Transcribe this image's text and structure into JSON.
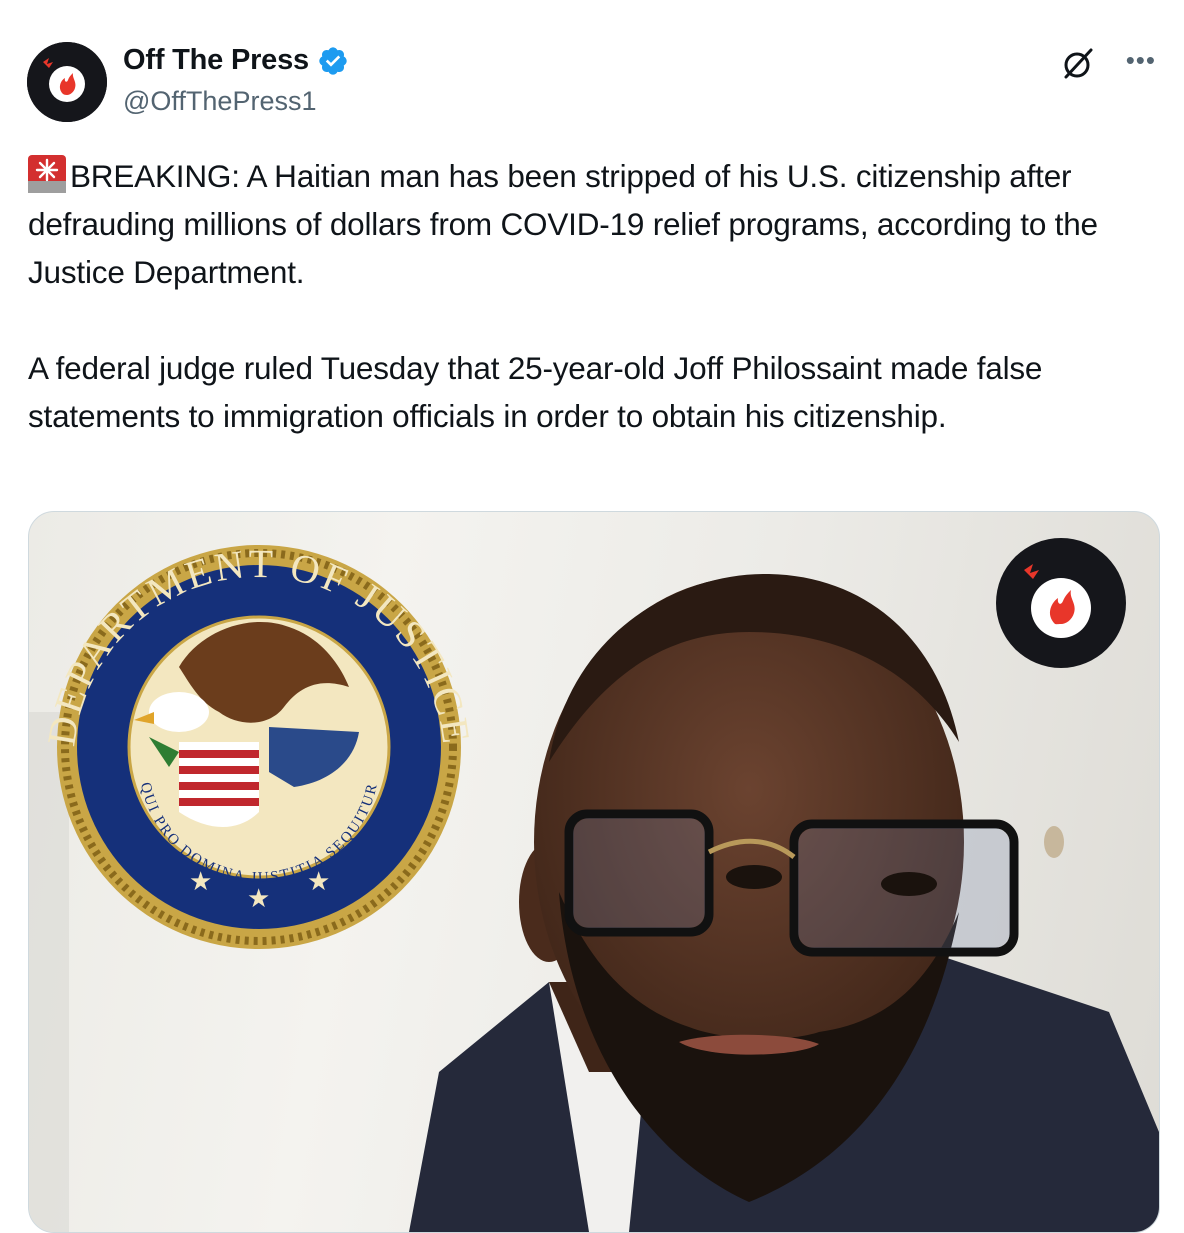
{
  "header": {
    "display_name": "Off The Press",
    "handle": "@OffThePress1",
    "verified": true
  },
  "icons": {
    "avatar": "off-the-press-logo",
    "verified": "verified-badge-icon",
    "grok": "grok-icon",
    "more": "more-icon",
    "siren": "siren-emoji"
  },
  "tweet": {
    "paragraph1": "BREAKING: A Haitian man has been stripped of his U.S. citizenship after defrauding millions of dollars from COVID-19 relief programs, according to the Justice Department.",
    "paragraph2": "A federal judge ruled Tuesday that 25-year-old Joff Philossaint made false statements to immigration officials in order to obtain his citizenship."
  },
  "media": {
    "seal_top_text": "DEPARTMENT OF JUSTICE",
    "seal_motto": "QUI PRO DOMINA JUSTITIA SEQUITUR"
  },
  "colors": {
    "text": "#0f1419",
    "secondary": "#536471",
    "verified_blue": "#1d9bf0",
    "logo_red": "#e8362a",
    "logo_dark": "#15161b"
  }
}
